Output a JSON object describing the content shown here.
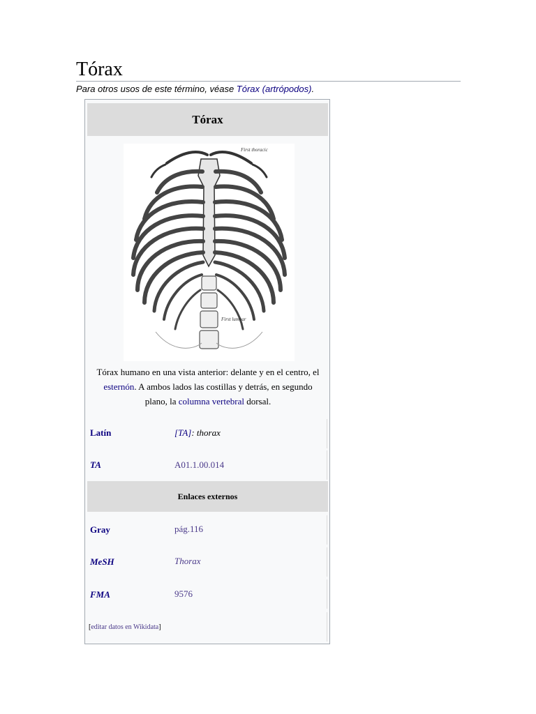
{
  "article": {
    "title": "Tórax",
    "hatnote": {
      "prefix": "Para otros usos de este término, véase ",
      "link": "Tórax (artrópodos)",
      "suffix": "."
    }
  },
  "infobox": {
    "header": "Tórax",
    "image": {
      "label_top": "First thoracic",
      "label_bottom": "First lumbar"
    },
    "caption": {
      "part1": "Tórax humano en una vista anterior: delante y en el centro, el ",
      "link1": "esternón",
      "part2": ". A ambos lados las costillas y detrás, en segundo plano, la ",
      "link2": "columna vertebral",
      "part3": " dorsal."
    },
    "rows": [
      {
        "label": "Latín",
        "value_link": "[TA]",
        "value_rest": ": thorax"
      },
      {
        "label": "TA",
        "value": "A01.1.00.014"
      }
    ],
    "section_header": "Enlaces externos",
    "external_links": [
      {
        "label": "Gray",
        "value": "pág.116"
      },
      {
        "label": "MeSH",
        "value": "Thorax"
      },
      {
        "label": "FMA",
        "value": "9576"
      }
    ],
    "edit": {
      "open": "[",
      "link": "editar datos en Wikidata",
      "close": "]"
    }
  }
}
